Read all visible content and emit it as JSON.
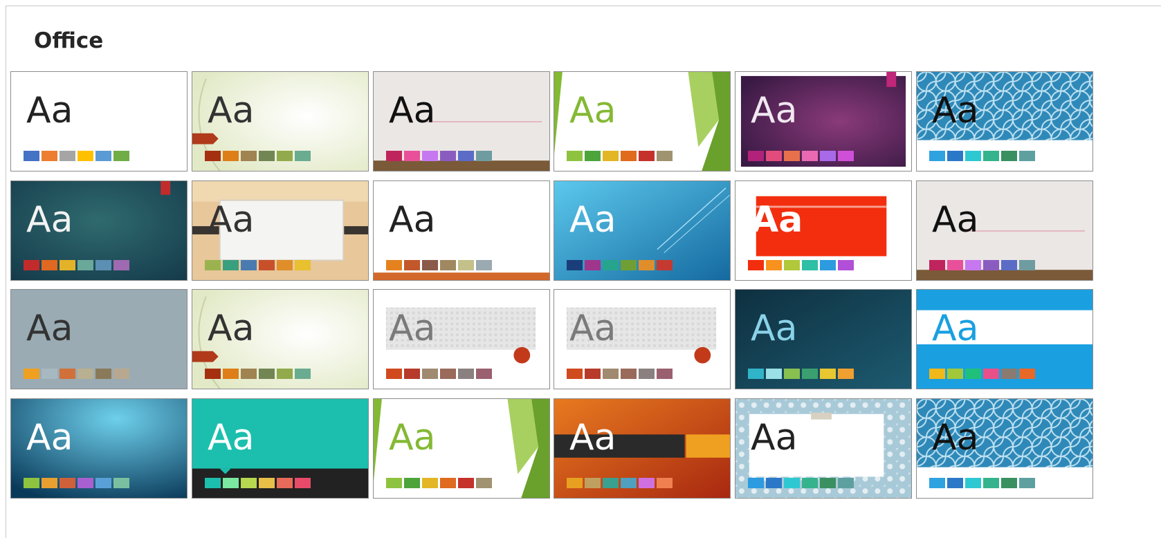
{
  "section": {
    "title": "Office"
  },
  "themes": [
    {
      "label": "Aa",
      "bg": "#ffffff",
      "text": "#222222",
      "swatches": [
        "#4472c4",
        "#ed7d31",
        "#a5a5a5",
        "#ffc000",
        "#5b9bd5",
        "#70ad47"
      ],
      "decor": "plain"
    },
    {
      "label": "Aa",
      "bg": "#f2f5e3",
      "text": "#333333",
      "swatches": [
        "#a53010",
        "#de7e18",
        "#9f8351",
        "#728653",
        "#92aa4c",
        "#6aac90"
      ],
      "decor": "leaf"
    },
    {
      "label": "Aa",
      "bg": "#ebe7e5",
      "text": "#111111",
      "swatches": [
        "#c0245c",
        "#e9509a",
        "#c678f0",
        "#8b5cc0",
        "#5b6cc6",
        "#6f9ca0"
      ],
      "decor": "wood"
    },
    {
      "label": "Aa",
      "bg": "#ffffff",
      "text": "#84b934",
      "swatches": [
        "#8ec33f",
        "#4da43b",
        "#e3b625",
        "#e06a1e",
        "#c4322b",
        "#a09370"
      ],
      "decor": "facet"
    },
    {
      "label": "Aa",
      "bg": "#4b2453",
      "text": "#f0e8f0",
      "swatches": [
        "#b3227a",
        "#e24c7c",
        "#e8714c",
        "#e96ab3",
        "#a86ae8",
        "#d04fd8"
      ],
      "decor": "purple"
    },
    {
      "label": "Aa",
      "bg": "#2f89b8",
      "text": "#111111",
      "swatches": [
        "#2fa2e0",
        "#2c78c8",
        "#2ec8d2",
        "#35b38c",
        "#3a9060",
        "#5ea0a0"
      ],
      "decor": "pattern"
    },
    {
      "label": "Aa",
      "bg": "#1d4e5a",
      "text": "#f2f2f2",
      "swatches": [
        "#c22b2b",
        "#e06820",
        "#e4b228",
        "#6aa89a",
        "#5c8fb4",
        "#9f6ab1"
      ],
      "decor": "teal"
    },
    {
      "label": "Aa",
      "bg": "#e8c79a",
      "text": "#333333",
      "swatches": [
        "#9bb34f",
        "#3a9f7f",
        "#4a7bb0",
        "#c7502b",
        "#e08e2a",
        "#e8c030"
      ],
      "decor": "banded"
    },
    {
      "label": "Aa",
      "bg": "#ffffff",
      "text": "#222222",
      "swatches": [
        "#e5821e",
        "#c2572b",
        "#8a5a4a",
        "#a08860",
        "#c4c08a",
        "#9aaab0"
      ],
      "decor": "orangeline"
    },
    {
      "label": "Aa",
      "bg": "#1f8ac4",
      "text": "#ffffff",
      "swatches": [
        "#1a3e7a",
        "#a0358c",
        "#26a58c",
        "#6f9f34",
        "#e08e2a",
        "#c43a30"
      ],
      "decor": "ion"
    },
    {
      "label": "Aa",
      "bg": "#ffffff",
      "text": "#ffffff",
      "swatches": [
        "#f22e0e",
        "#f7921e",
        "#b1c83a",
        "#2ebfa5",
        "#2c9be0",
        "#b14fd8"
      ],
      "decor": "redblock"
    },
    {
      "label": "Aa",
      "bg": "#ebe7e5",
      "text": "#111111",
      "swatches": [
        "#c0245c",
        "#e9509a",
        "#c678f0",
        "#8b5cc0",
        "#5b6cc6",
        "#6f9ca0"
      ],
      "decor": "wood"
    },
    {
      "label": "Aa",
      "bg": "#9aabb4",
      "text": "#333333",
      "swatches": [
        "#f0a020",
        "#a8b8c0",
        "#d0703a",
        "#b8b090",
        "#8a7a5a",
        "#b8a890"
      ],
      "decor": "plain"
    },
    {
      "label": "Aa",
      "bg": "#f2f5e3",
      "text": "#333333",
      "swatches": [
        "#a53010",
        "#de7e18",
        "#9f8351",
        "#728653",
        "#92aa4c",
        "#6aac90"
      ],
      "decor": "leaf"
    },
    {
      "label": "Aa",
      "bg": "#ffffff",
      "text": "#7a7a7a",
      "swatches": [
        "#d04a1e",
        "#b83a2a",
        "#a08a70",
        "#9a6a5a",
        "#8a8080",
        "#9a6070"
      ],
      "decor": "paper"
    },
    {
      "label": "Aa",
      "bg": "#ffffff",
      "text": "#7a7a7a",
      "swatches": [
        "#d04a1e",
        "#b83a2a",
        "#a08a70",
        "#9a6a5a",
        "#8a8080",
        "#9a6070"
      ],
      "decor": "paper"
    },
    {
      "label": "Aa",
      "bg": "#123b4e",
      "text": "#8ad2e8",
      "swatches": [
        "#30b4c8",
        "#9ae0e6",
        "#88c050",
        "#3aa070",
        "#e8c830",
        "#f0a030"
      ],
      "decor": "darkteal"
    },
    {
      "label": "Aa",
      "bg": "#1aa0e0",
      "text": "#1aa0e0",
      "swatches": [
        "#f0b818",
        "#a0c83a",
        "#20c07a",
        "#e8508a",
        "#8a7a70",
        "#e86828"
      ],
      "decor": "band"
    },
    {
      "label": "Aa",
      "bg": "#0f5a80",
      "text": "#ffffff",
      "swatches": [
        "#8ec33f",
        "#e8a030",
        "#d0603a",
        "#a860d0",
        "#5aa0d8",
        "#7ac0a0"
      ],
      "decor": "drop"
    },
    {
      "label": "Aa",
      "bg": "#1cbfae",
      "text": "#ffffff",
      "swatches": [
        "#1cbfae",
        "#7ae8a0",
        "#b8d850",
        "#e8c048",
        "#e86a5a",
        "#e84a6a"
      ],
      "decor": "tealdark"
    },
    {
      "label": "Aa",
      "bg": "#ffffff",
      "text": "#84b934",
      "swatches": [
        "#8ec33f",
        "#4da43b",
        "#e3b625",
        "#e06a1e",
        "#c4322b",
        "#a09370"
      ],
      "decor": "facet"
    },
    {
      "label": "Aa",
      "bg": "#c8401a",
      "text": "#ffffff",
      "swatches": [
        "#e8a020",
        "#c0a060",
        "#3aa090",
        "#50a0c0",
        "#d070e0",
        "#f08050"
      ],
      "decor": "orangebar"
    },
    {
      "label": "Aa",
      "bg": "#a8cad8",
      "text": "#222222",
      "swatches": [
        "#2c9be0",
        "#2c78c8",
        "#2ec8d2",
        "#35b38c",
        "#3a9060",
        "#5ea0a0"
      ],
      "decor": "floral"
    },
    {
      "label": "Aa",
      "bg": "#2f89b8",
      "text": "#111111",
      "swatches": [
        "#2fa2e0",
        "#2c78c8",
        "#2ec8d2",
        "#35b38c",
        "#3a9060",
        "#5ea0a0"
      ],
      "decor": "pattern"
    }
  ]
}
